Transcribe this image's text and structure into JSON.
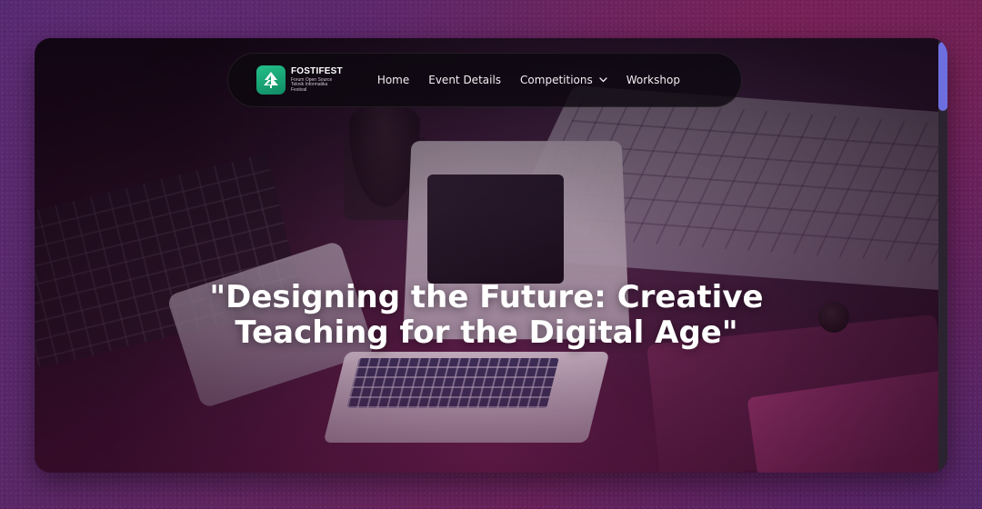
{
  "nav": {
    "logo": {
      "title": "FOSTIFEST",
      "subtitle": "Forum Open Source Teknik Informatika Festival",
      "icon": "fostifest-logo-icon",
      "color": "#1aa877"
    },
    "links": [
      {
        "label": "Home"
      },
      {
        "label": "Event Details"
      },
      {
        "label": "Competitions",
        "has_dropdown": true
      },
      {
        "label": "Workshop"
      }
    ]
  },
  "hero": {
    "title_line_1": "\"Designing the Future: Creative",
    "title_line_2": "Teaching for the Digital Age\""
  },
  "scrollbar": {
    "thumb_color": "#6d6fe0"
  }
}
